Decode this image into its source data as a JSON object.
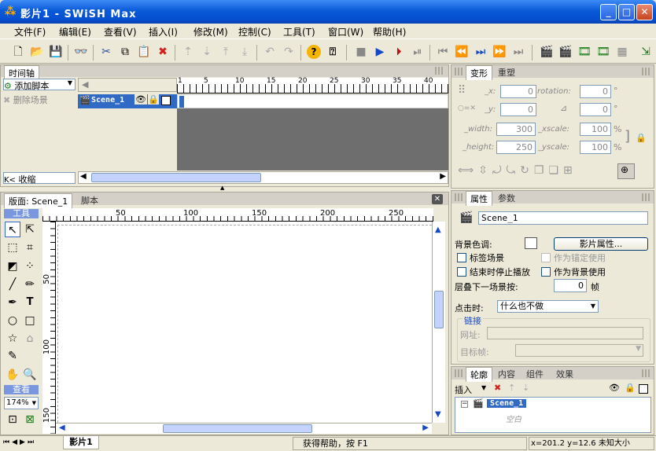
{
  "window": {
    "title": "影片1 - SWiSH Max",
    "app_icon": "swish-icon"
  },
  "menu": [
    "文件(F)",
    "编辑(E)",
    "查看(V)",
    "插入(I)",
    "修改(M)",
    "控制(C)",
    "工具(T)",
    "窗口(W)",
    "帮助(H)"
  ],
  "timeline": {
    "tab": "时间轴",
    "add_script": "添加脚本",
    "delete_scene": "删除场景",
    "collapse": "收缩",
    "scene_name": "Scene_1",
    "frames": [
      "1",
      "5",
      "10",
      "15",
      "20",
      "25",
      "30",
      "35",
      "40"
    ]
  },
  "layout_panel": {
    "tab": "版面: Scene_1",
    "tab2": "脚本",
    "tools_label": "工具",
    "view_label": "查看",
    "zoom": "174%",
    "ruler_top": [
      "50",
      "100",
      "150",
      "200",
      "250"
    ],
    "ruler_left": [
      "50",
      "100",
      "150"
    ]
  },
  "transform": {
    "tab": "变形",
    "tab2": "重塑",
    "x_label": "_x:",
    "x_val": "0",
    "rotation_label": "rotation:",
    "rotation_val": "0",
    "y_label": "_y:",
    "y_val": "0",
    "skew_val": "0",
    "width_label": "_width:",
    "width_val": "300",
    "xscale_label": "_xscale:",
    "xscale_val": "100",
    "height_label": "_height:",
    "height_val": "250",
    "yscale_label": "_yscale:",
    "yscale_val": "100",
    "pct": "%",
    "deg": "°"
  },
  "properties": {
    "tab": "属性",
    "tab2": "参数",
    "scene_name": "Scene_1",
    "bg_color_label": "背景色调:",
    "movie_props": "影片属性...",
    "label_scene": "标签场景",
    "as_anchor": "作为锚定使用",
    "stop_at_end": "结束时停止播放",
    "as_bg": "作为背景使用",
    "overlap_label": "层叠下一场景按:",
    "overlap_val": "0",
    "frames_unit": "帧",
    "on_click_label": "点击时:",
    "on_click_val": "什么也不做",
    "link_title": "链接",
    "url_label": "网址:",
    "target_label": "目标帧:"
  },
  "outline": {
    "tabs": [
      "轮廓",
      "内容",
      "组件",
      "效果"
    ],
    "insert": "插入",
    "scene": "Scene_1",
    "empty": "空白"
  },
  "status": {
    "movie_tab": "影片1",
    "help": "获得帮助，按 F1",
    "coords": "x=201.2 y=12.6 未知大小"
  }
}
